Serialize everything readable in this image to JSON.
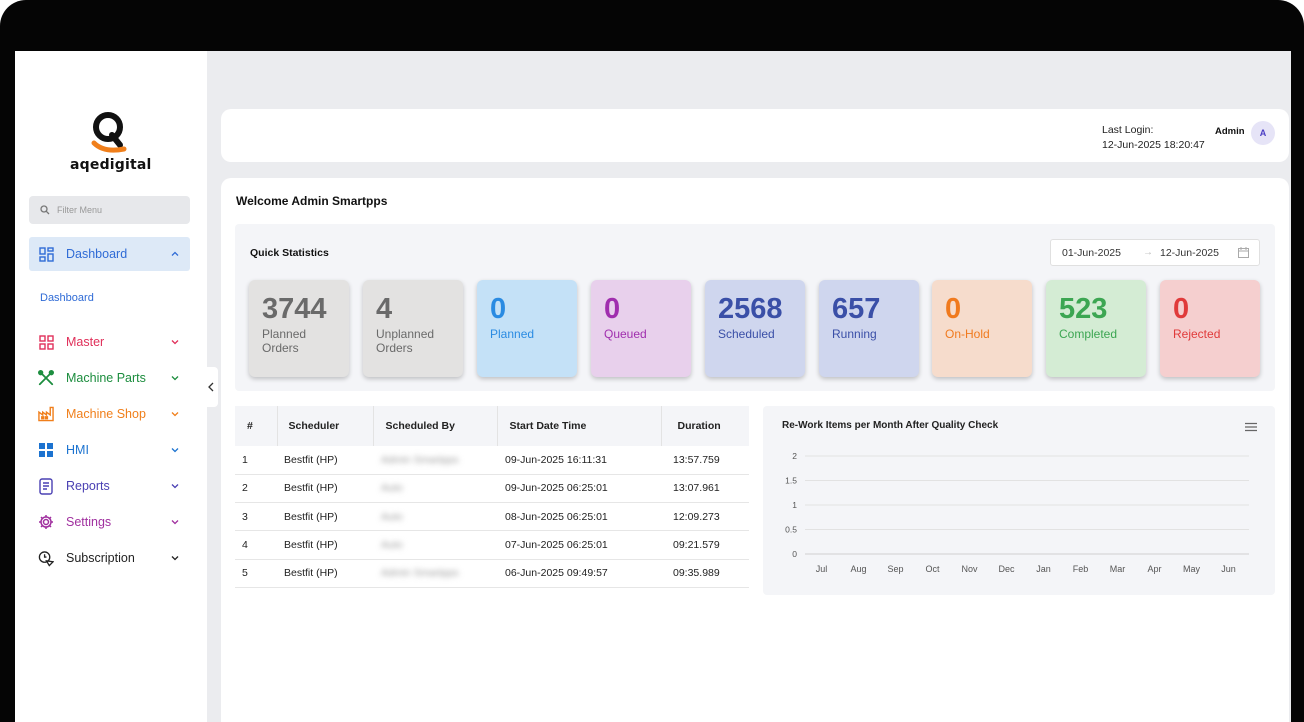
{
  "app": {
    "logo_text": "aqedigital"
  },
  "sidebar": {
    "filter_placeholder": "Filter Menu",
    "items": [
      {
        "label": "Dashboard",
        "icon": "grid-icon",
        "color": "#2f6bd6",
        "expanded": true
      },
      {
        "label": "Master",
        "icon": "boxes-icon",
        "color": "#e0305a"
      },
      {
        "label": "Machine Parts",
        "icon": "tools-icon",
        "color": "#1c8d3e"
      },
      {
        "label": "Machine Shop",
        "icon": "factory-icon",
        "color": "#f07f1b"
      },
      {
        "label": "HMI",
        "icon": "windows-icon",
        "color": "#1c73d0"
      },
      {
        "label": "Reports",
        "icon": "report-icon",
        "color": "#4a40b3"
      },
      {
        "label": "Settings",
        "icon": "gear-icon",
        "color": "#a0309f"
      },
      {
        "label": "Subscription",
        "icon": "subscription-icon",
        "color": "#222222"
      }
    ],
    "sub_items": [
      "Dashboard"
    ]
  },
  "header": {
    "last_login_label": "Last Login:",
    "last_login_value": "12-Jun-2025 18:20:47",
    "user_name": "Admin",
    "avatar_initial": "A"
  },
  "main": {
    "welcome": "Welcome Admin Smartpps",
    "quick_stats": {
      "title": "Quick Statistics",
      "date_from": "01-Jun-2025",
      "date_to": "12-Jun-2025",
      "cards": [
        {
          "value": "3744",
          "label": "Planned Orders",
          "bg": "#e3e2e1",
          "fg": "#6a6a6a"
        },
        {
          "value": "4",
          "label": "Unplanned Orders",
          "bg": "#e3e2e1",
          "fg": "#6a6a6a"
        },
        {
          "value": "0",
          "label": "Planned",
          "bg": "#c4e1f7",
          "fg": "#2a8be2"
        },
        {
          "value": "0",
          "label": "Queued",
          "bg": "#e8d0ec",
          "fg": "#a02eae"
        },
        {
          "value": "2568",
          "label": "Scheduled",
          "bg": "#cfd6ee",
          "fg": "#3a4fa7"
        },
        {
          "value": "657",
          "label": "Running",
          "bg": "#cfd6ee",
          "fg": "#3a4fa7"
        },
        {
          "value": "0",
          "label": "On-Hold",
          "bg": "#f6dccc",
          "fg": "#f07a1e"
        },
        {
          "value": "523",
          "label": "Completed",
          "bg": "#d4ecd4",
          "fg": "#3ca652"
        },
        {
          "value": "0",
          "label": "Rejected",
          "bg": "#f5cfcf",
          "fg": "#e03a3a"
        }
      ]
    },
    "schedule_table": {
      "columns": [
        "#",
        "Scheduler",
        "Scheduled By",
        "Start Date Time",
        "Duration"
      ],
      "rows": [
        [
          "1",
          "Bestfit (HP)",
          "Admin Smartpps",
          "09-Jun-2025 16:11:31",
          "13:57.759"
        ],
        [
          "2",
          "Bestfit (HP)",
          "Auto",
          "09-Jun-2025 06:25:01",
          "13:07.961"
        ],
        [
          "3",
          "Bestfit (HP)",
          "Auto",
          "08-Jun-2025 06:25:01",
          "12:09.273"
        ],
        [
          "4",
          "Bestfit (HP)",
          "Auto",
          "07-Jun-2025 06:25:01",
          "09:21.579"
        ],
        [
          "5",
          "Bestfit (HP)",
          "Admin Smartpps",
          "06-Jun-2025 09:49:57",
          "09:35.989"
        ]
      ]
    },
    "chart_data": {
      "type": "line",
      "title": "Re-Work Items per Month After Quality Check",
      "categories": [
        "Jul",
        "Aug",
        "Sep",
        "Oct",
        "Nov",
        "Dec",
        "Jan",
        "Feb",
        "Mar",
        "Apr",
        "May",
        "Jun"
      ],
      "series": [
        {
          "values": [
            0,
            0,
            0,
            0,
            0,
            0,
            0,
            0,
            0,
            0,
            0,
            0
          ]
        }
      ],
      "yticks": [
        "0",
        "0.5",
        "1",
        "1.5",
        "2"
      ],
      "ylim": [
        0,
        2
      ],
      "grid": true
    }
  }
}
